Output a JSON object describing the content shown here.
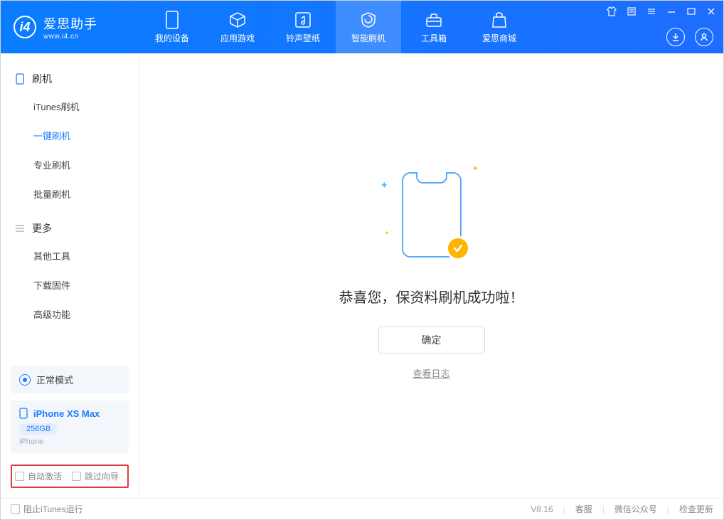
{
  "app": {
    "name": "爱思助手",
    "url": "www.i4.cn"
  },
  "tabs": [
    {
      "label": "我的设备"
    },
    {
      "label": "应用游戏"
    },
    {
      "label": "铃声壁纸"
    },
    {
      "label": "智能刷机"
    },
    {
      "label": "工具箱"
    },
    {
      "label": "爱思商城"
    }
  ],
  "sidebar": {
    "section1": {
      "title": "刷机"
    },
    "items1": [
      {
        "label": "iTunes刷机"
      },
      {
        "label": "一键刷机"
      },
      {
        "label": "专业刷机"
      },
      {
        "label": "批量刷机"
      }
    ],
    "section2": {
      "title": "更多"
    },
    "items2": [
      {
        "label": "其他工具"
      },
      {
        "label": "下载固件"
      },
      {
        "label": "高级功能"
      }
    ],
    "mode": "正常模式",
    "device": {
      "name": "iPhone XS Max",
      "storage": "256GB",
      "type": "iPhone"
    },
    "checkboxes": {
      "auto_activate": "自动激活",
      "skip_guide": "跳过向导"
    }
  },
  "main": {
    "message": "恭喜您，保资料刷机成功啦！",
    "ok_button": "确定",
    "view_log": "查看日志"
  },
  "footer": {
    "block_itunes": "阻止iTunes运行",
    "version": "V8.16",
    "links": {
      "support": "客服",
      "wechat": "微信公众号",
      "update": "检查更新"
    }
  }
}
